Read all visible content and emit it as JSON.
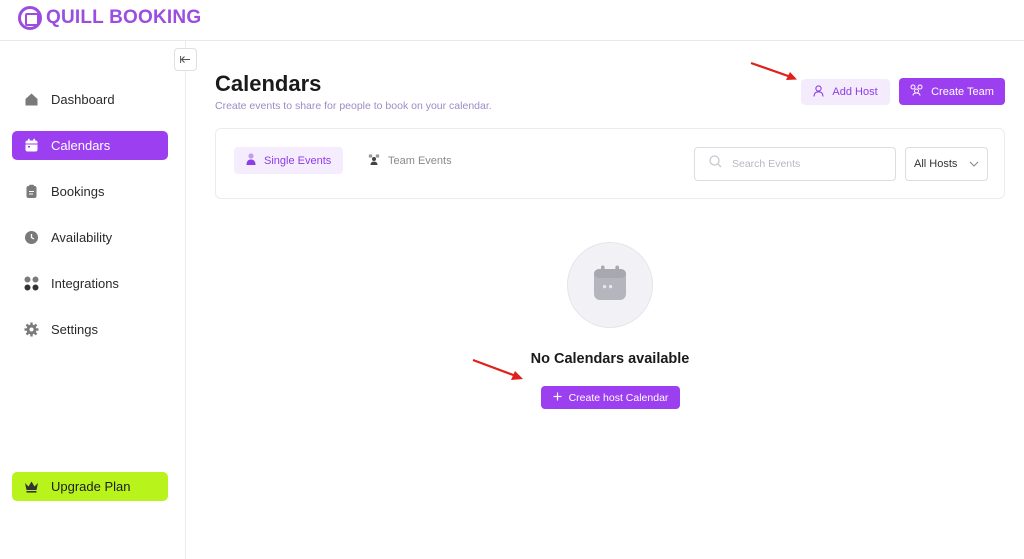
{
  "app": {
    "logo_text": "QUILL BOOKING",
    "brand_color": "#9b3ff0",
    "upgrade_color": "#b8f41b"
  },
  "sidebar": {
    "items": [
      {
        "label": "Dashboard",
        "icon": "home-icon",
        "active": false
      },
      {
        "label": "Calendars",
        "icon": "calendar-icon",
        "active": true
      },
      {
        "label": "Bookings",
        "icon": "clipboard-icon",
        "active": false
      },
      {
        "label": "Availability",
        "icon": "clock-icon",
        "active": false
      },
      {
        "label": "Integrations",
        "icon": "grid-dots-icon",
        "active": false
      },
      {
        "label": "Settings",
        "icon": "gear-icon",
        "active": false
      }
    ],
    "upgrade_label": "Upgrade Plan",
    "collapse_icon": "collapse-arrow-icon"
  },
  "page": {
    "title": "Calendars",
    "subtitle": "Create events to share for people to book on your calendar.",
    "add_host_label": "Add Host",
    "create_team_label": "Create Team"
  },
  "filters": {
    "tabs": [
      {
        "label": "Single Events",
        "active": true
      },
      {
        "label": "Team Events",
        "active": false
      }
    ],
    "search_placeholder": "Search Events",
    "search_value": "",
    "hosts_selected": "All Hosts"
  },
  "empty_state": {
    "title": "No Calendars available",
    "button_label": "Create host Calendar"
  }
}
